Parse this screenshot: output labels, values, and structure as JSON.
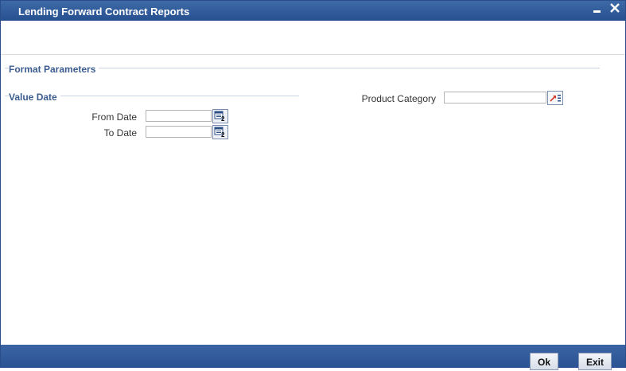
{
  "window": {
    "title": "Lending Forward Contract Reports",
    "minimize_glyph": "▬",
    "close_glyph": "✕"
  },
  "format_parameters": {
    "legend": "Format Parameters"
  },
  "value_date": {
    "legend": "Value Date",
    "from_label": "From Date",
    "from_value": "",
    "to_label": "To Date",
    "to_value": ""
  },
  "product_category": {
    "label": "Product Category",
    "value": ""
  },
  "icons": {
    "calendar": "calendar-icon",
    "lov": "list-of-values-icon"
  },
  "buttons": {
    "ok": "Ok",
    "exit": "Exit"
  },
  "colors": {
    "title_bar": "#2f5a99",
    "legend_text": "#3c5d8f",
    "footer_bar": "#2f5a99"
  }
}
